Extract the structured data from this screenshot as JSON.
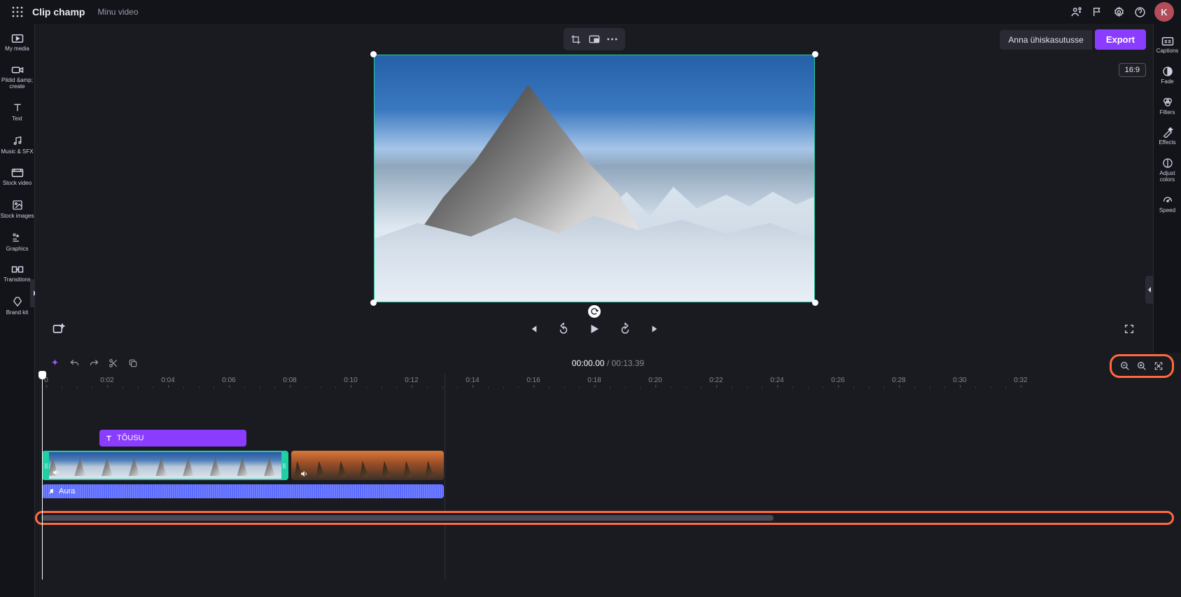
{
  "header": {
    "brand": "Clip champ",
    "project": "Minu video",
    "share_label": "Anna ühiskasutusse",
    "export_label": "Export",
    "avatar_initial": "K"
  },
  "aspect_ratio": "16:9",
  "left_rail": [
    {
      "label": "My media"
    },
    {
      "label": "Pildid &amp; create"
    },
    {
      "label": "Text"
    },
    {
      "label": "Music & SFX"
    },
    {
      "label": "Stock video"
    },
    {
      "label": "Stock images"
    },
    {
      "label": "Graphics"
    },
    {
      "label": "Transitions"
    },
    {
      "label": "Brand kit"
    }
  ],
  "right_rail": [
    {
      "label": "Captions"
    },
    {
      "label": "Fade"
    },
    {
      "label": "Filters"
    },
    {
      "label": "Effects"
    },
    {
      "label": "Adjust colors"
    },
    {
      "label": "Speed"
    }
  ],
  "playback": {
    "current": "00:00.00",
    "duration": "00:13.39"
  },
  "ruler_ticks": [
    "0",
    "0:02",
    "0:04",
    "0:06",
    "0:08",
    "0:10",
    "0:12",
    "0:14",
    "0:16",
    "0:18",
    "0:20",
    "0:22",
    "0:24",
    "0:26",
    "0:28",
    "0:30",
    "0:32"
  ],
  "clips": {
    "text_label": "TÕUSU",
    "audio_label": "Aura"
  }
}
